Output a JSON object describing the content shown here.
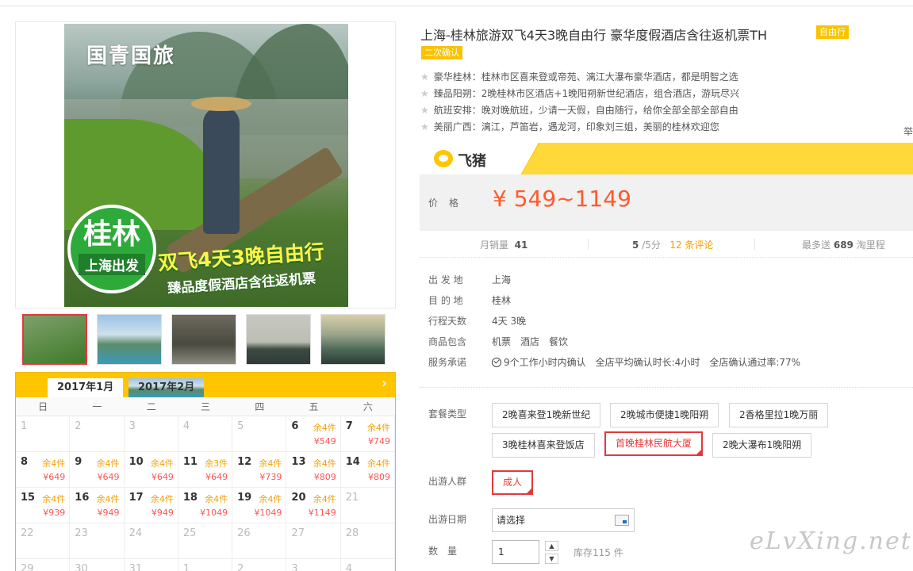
{
  "gallery": {
    "brand": "国青国旅",
    "badge_main": "桂林",
    "badge_sub": "上海出发",
    "promo_title": "双飞4天3晚自由行",
    "promo_sub": "臻品度假酒店含往返机票",
    "thumbnails": [
      "thumb-1",
      "thumb-2",
      "thumb-3",
      "thumb-4",
      "thumb-5"
    ]
  },
  "calendar": {
    "tabs": [
      "2017年1月",
      "2017年2月"
    ],
    "weekdays": [
      "日",
      "一",
      "二",
      "三",
      "四",
      "五",
      "六"
    ],
    "days": [
      {
        "d": "1",
        "dim": true
      },
      {
        "d": "2",
        "dim": true
      },
      {
        "d": "3",
        "dim": true
      },
      {
        "d": "4",
        "dim": true
      },
      {
        "d": "5",
        "dim": true
      },
      {
        "d": "6",
        "stock": "余4件",
        "price": "¥549"
      },
      {
        "d": "7",
        "stock": "余4件",
        "price": "¥749"
      },
      {
        "d": "8",
        "stock": "余4件",
        "price": "¥649"
      },
      {
        "d": "9",
        "stock": "余4件",
        "price": "¥649"
      },
      {
        "d": "10",
        "stock": "余4件",
        "price": "¥649"
      },
      {
        "d": "11",
        "stock": "余3件",
        "price": "¥649"
      },
      {
        "d": "12",
        "stock": "余4件",
        "price": "¥739"
      },
      {
        "d": "13",
        "stock": "余4件",
        "price": "¥809"
      },
      {
        "d": "14",
        "stock": "余4件",
        "price": "¥809"
      },
      {
        "d": "15",
        "stock": "余4件",
        "price": "¥939"
      },
      {
        "d": "16",
        "stock": "余4件",
        "price": "¥949"
      },
      {
        "d": "17",
        "stock": "余4件",
        "price": "¥949"
      },
      {
        "d": "18",
        "stock": "余4件",
        "price": "¥1049"
      },
      {
        "d": "19",
        "stock": "余4件",
        "price": "¥1049"
      },
      {
        "d": "20",
        "stock": "余4件",
        "price": "¥1149"
      },
      {
        "d": "21",
        "dim": true
      },
      {
        "d": "22",
        "dim": true
      },
      {
        "d": "23",
        "dim": true
      },
      {
        "d": "24",
        "dim": true
      },
      {
        "d": "25",
        "dim": true
      },
      {
        "d": "26",
        "dim": true
      },
      {
        "d": "27",
        "dim": true
      },
      {
        "d": "28",
        "dim": true
      },
      {
        "d": "29",
        "dim": true
      },
      {
        "d": "30",
        "dim": true
      },
      {
        "d": "31",
        "dim": true
      },
      {
        "d": "1",
        "dim": true
      },
      {
        "d": "2",
        "dim": true
      },
      {
        "d": "3",
        "dim": true
      },
      {
        "d": "4",
        "dim": true
      }
    ]
  },
  "product": {
    "title": "上海-桂林旅游双飞4天3晚自由行 豪华度假酒店含往返机票TH",
    "tag_free": "自由行",
    "tag_confirm": "二次确认",
    "features": [
      "豪华桂林：桂林市区喜来登或帝苑、漓江大瀑布豪华酒店，都是明智之选",
      "臻品阳朔：2晚桂林市区酒店+1晚阳朔新世纪酒店，组合酒店，游玩尽兴",
      "航班安排：晚对晚航班，少请一天假，自由随行，给你全部全部全部自由",
      "美丽广西：漓江，芦笛岩，遇龙河，印象刘三姐，美丽的桂林欢迎您"
    ],
    "side_char": "举"
  },
  "fliggy": {
    "logo_text": "飞猪"
  },
  "price": {
    "label": "价格",
    "value": "¥ 549~1149"
  },
  "stats": {
    "monthly_label": "月销量",
    "monthly_value": "41",
    "rating_value": "5",
    "rating_suffix": "/5分",
    "reviews": "12 条评论",
    "points_prefix": "最多送",
    "points_value": "689",
    "points_suffix": "淘里程"
  },
  "info": {
    "departure_label": "出 发 地",
    "departure": "上海",
    "destination_label": "目 的 地",
    "destination": "桂林",
    "days_label": "行程天数",
    "days": "4天 3晚",
    "includes_label": "商品包含",
    "includes": "机票　酒店　餐饮",
    "service_label": "服务承诺",
    "service_1": "9个工作小时内确认",
    "service_2": "全店平均确认时长:4小时",
    "service_3": "全店确认通过率:77%"
  },
  "options": {
    "package_label": "套餐类型",
    "packages": [
      "2晚喜来登1晚新世纪",
      "2晚城市便捷1晚阳朔",
      "2香格里拉1晚万丽",
      "3晚桂林喜来登饭店",
      "首晚桂林民航大厦",
      "2晚大瀑布1晚阳朔"
    ],
    "crowd_label": "出游人群",
    "crowd": "成人",
    "date_label": "出游日期",
    "date_value": "请选择",
    "qty_label": "数　量",
    "qty_value": "1",
    "stock": "库存115 件"
  },
  "watermark": "eLvXing.net"
}
